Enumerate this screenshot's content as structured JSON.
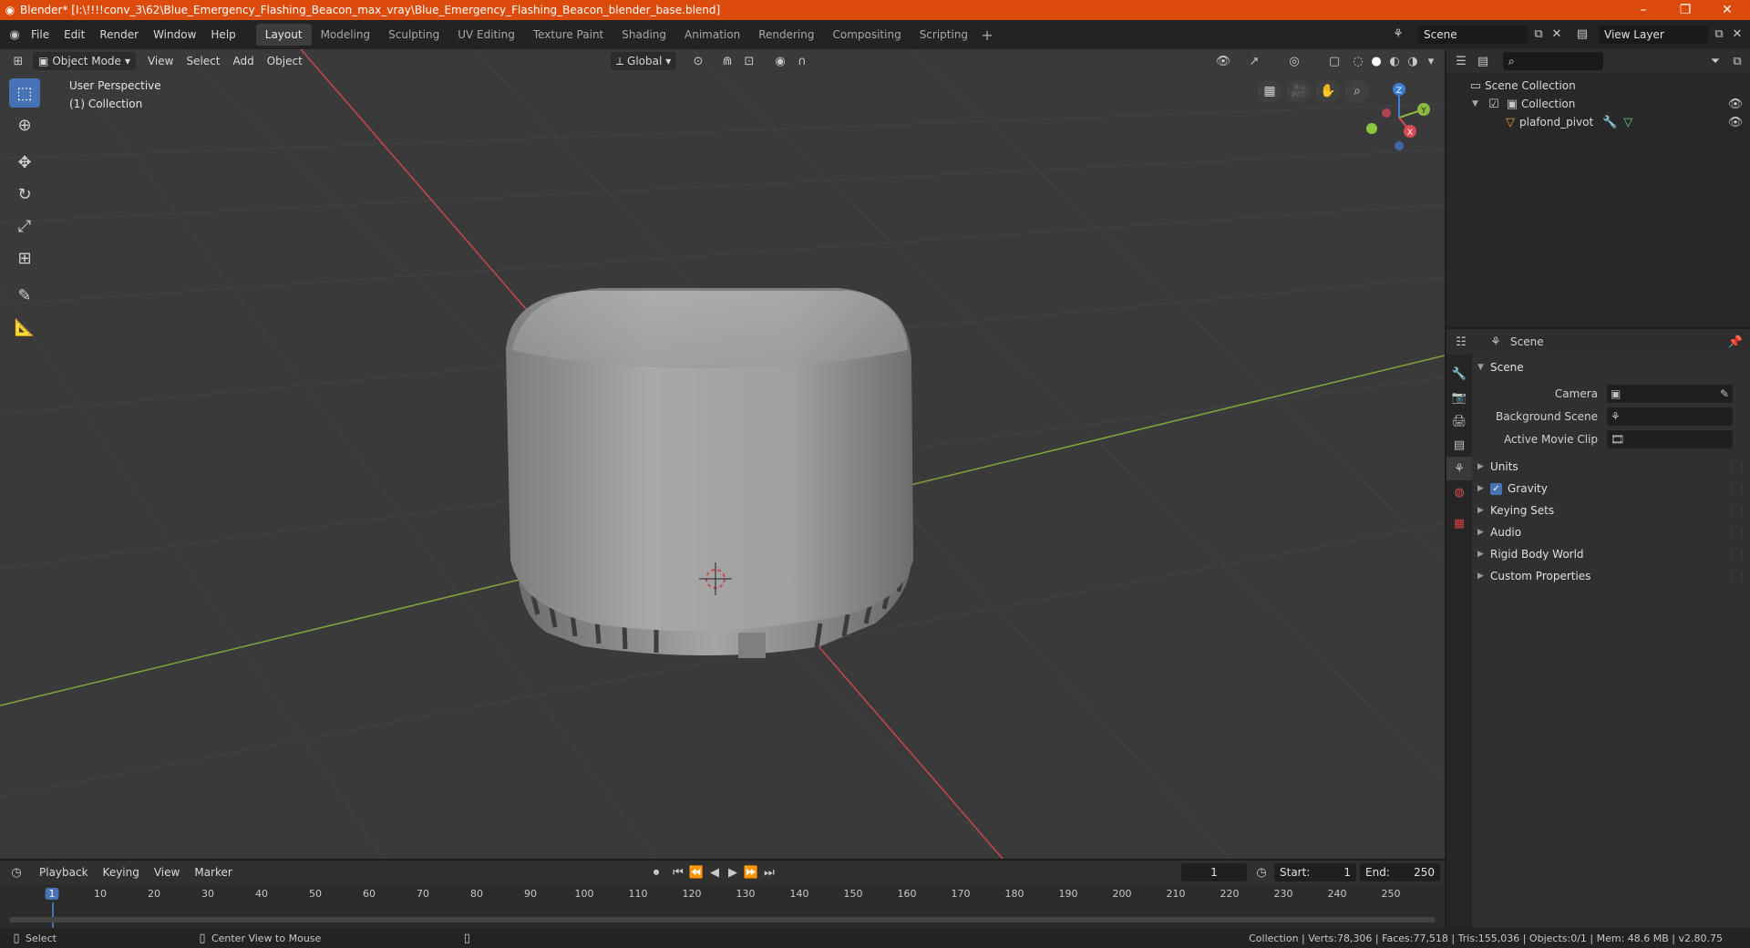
{
  "window": {
    "title": "Blender* [I:\\!!!!conv_3\\62\\Blue_Emergency_Flashing_Beacon_max_vray\\Blue_Emergency_Flashing_Beacon_blender_base.blend]",
    "minimize": "–",
    "maximize": "❐",
    "close": "✕"
  },
  "menubar": {
    "items": [
      "File",
      "Edit",
      "Render",
      "Window",
      "Help"
    ]
  },
  "workspaces": {
    "tabs": [
      "Layout",
      "Modeling",
      "Sculpting",
      "UV Editing",
      "Texture Paint",
      "Shading",
      "Animation",
      "Rendering",
      "Compositing",
      "Scripting"
    ],
    "active": "Layout",
    "add": "+"
  },
  "scene_selector": {
    "value": "Scene"
  },
  "viewlayer_selector": {
    "value": "View Layer"
  },
  "viewport": {
    "mode": "Object Mode",
    "menus": [
      "View",
      "Select",
      "Add",
      "Object"
    ],
    "transform_orientation": "Global",
    "info_line1": "User Perspective",
    "info_line2": "(1) Collection",
    "gizmo_axes": {
      "x": "X",
      "y": "Y",
      "z": "Z"
    },
    "colors": {
      "x_axis": "#c8464f",
      "y_axis": "#7fa63a",
      "background": "#3a3a3a",
      "grid": "#434343"
    }
  },
  "outliner": {
    "root": "Scene Collection",
    "collection": "Collection",
    "object": "plafond_pivot"
  },
  "properties": {
    "header_title": "Scene",
    "panel_title": "Scene",
    "fields": [
      {
        "label": "Camera",
        "value": ""
      },
      {
        "label": "Background Scene",
        "value": ""
      },
      {
        "label": "Active Movie Clip",
        "value": ""
      }
    ],
    "subpanels": [
      "Units",
      "Gravity",
      "Keying Sets",
      "Audio",
      "Rigid Body World",
      "Custom Properties"
    ],
    "gravity_checked": true
  },
  "timeline": {
    "menus": [
      "Playback",
      "Keying",
      "View",
      "Marker"
    ],
    "current_frame": "1",
    "start_label": "Start:",
    "start": "1",
    "end_label": "End:",
    "end": "250",
    "ruler": [
      "10",
      "20",
      "30",
      "40",
      "50",
      "60",
      "70",
      "80",
      "90",
      "100",
      "110",
      "120",
      "130",
      "140",
      "150",
      "160",
      "170",
      "180",
      "190",
      "200",
      "210",
      "220",
      "230",
      "240",
      "250"
    ],
    "ruler_current": "1"
  },
  "statusbar": {
    "left1": "Select",
    "left2": "Center View to Mouse",
    "stats": "Collection | Verts:78,306 | Faces:77,518 | Tris:155,036 | Objects:0/1 | Mem: 48.6 MB | v2.80.75"
  }
}
